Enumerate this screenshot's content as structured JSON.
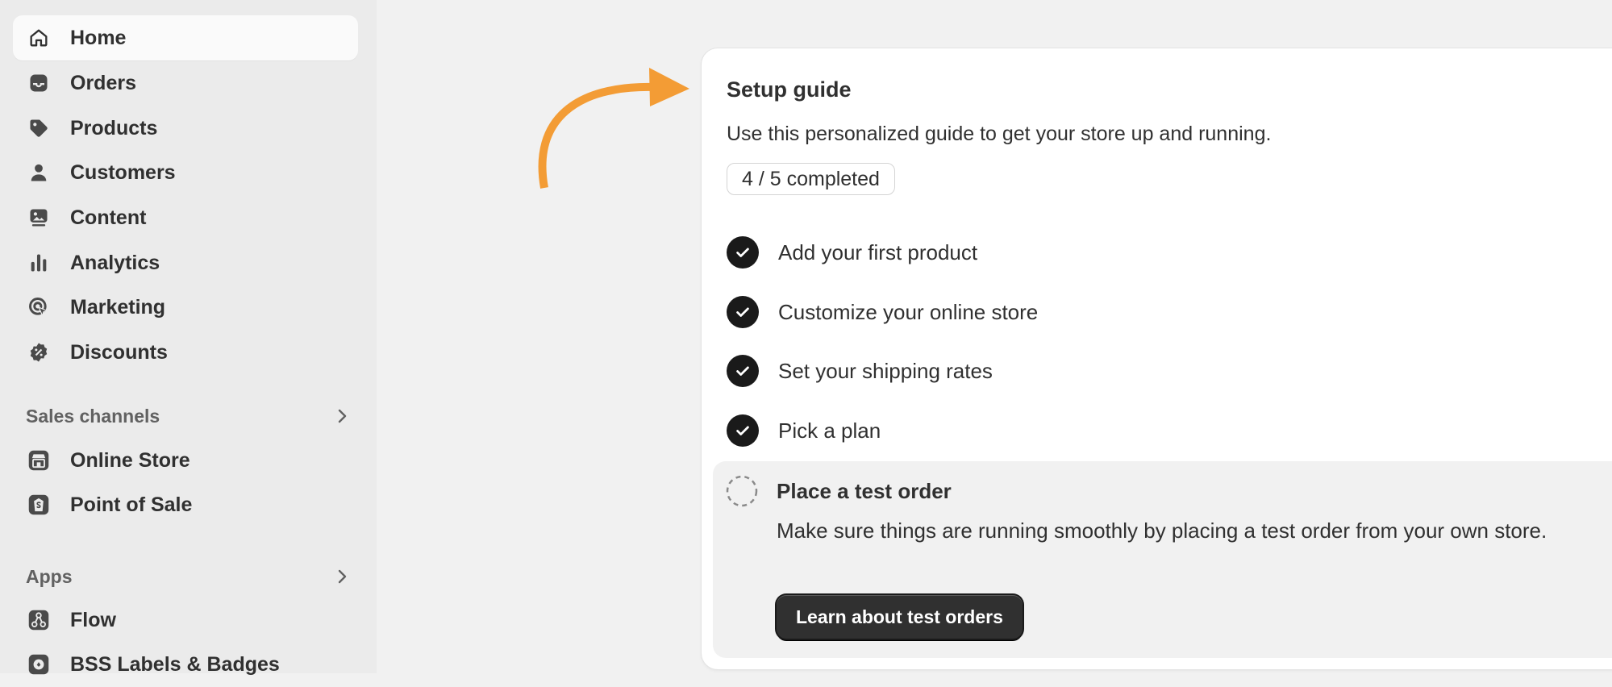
{
  "sidebar": {
    "items": [
      {
        "label": "Home",
        "icon": "home-icon",
        "active": true
      },
      {
        "label": "Orders",
        "icon": "inbox-icon"
      },
      {
        "label": "Products",
        "icon": "tag-icon"
      },
      {
        "label": "Customers",
        "icon": "person-icon"
      },
      {
        "label": "Content",
        "icon": "image-icon"
      },
      {
        "label": "Analytics",
        "icon": "bar-chart-icon"
      },
      {
        "label": "Marketing",
        "icon": "target-icon"
      },
      {
        "label": "Discounts",
        "icon": "discount-icon"
      }
    ],
    "sales_channels": {
      "title": "Sales channels",
      "items": [
        {
          "label": "Online Store",
          "icon": "storefront-icon"
        },
        {
          "label": "Point of Sale",
          "icon": "pos-icon"
        }
      ]
    },
    "apps": {
      "title": "Apps",
      "items": [
        {
          "label": "Flow",
          "icon": "flow-icon"
        },
        {
          "label": "BSS Labels & Badges",
          "icon": "bss-icon"
        }
      ]
    }
  },
  "setup_guide": {
    "title": "Setup guide",
    "description": "Use this personalized guide to get your store up and running.",
    "progress": "4 / 5 completed",
    "completed_count": 4,
    "total_count": 5,
    "tasks": [
      {
        "label": "Add your first product",
        "done": true
      },
      {
        "label": "Customize your online store",
        "done": true
      },
      {
        "label": "Set your shipping rates",
        "done": true
      },
      {
        "label": "Pick a plan",
        "done": true
      }
    ],
    "open_task": {
      "title": "Place a test order",
      "description": "Make sure things are running smoothly by placing a test order from your own store.",
      "button_label": "Learn about test orders"
    }
  },
  "colors": {
    "accent_arrow": "#f39c35",
    "check_fill": "#1a1a1a",
    "button_bg": "#303030"
  }
}
